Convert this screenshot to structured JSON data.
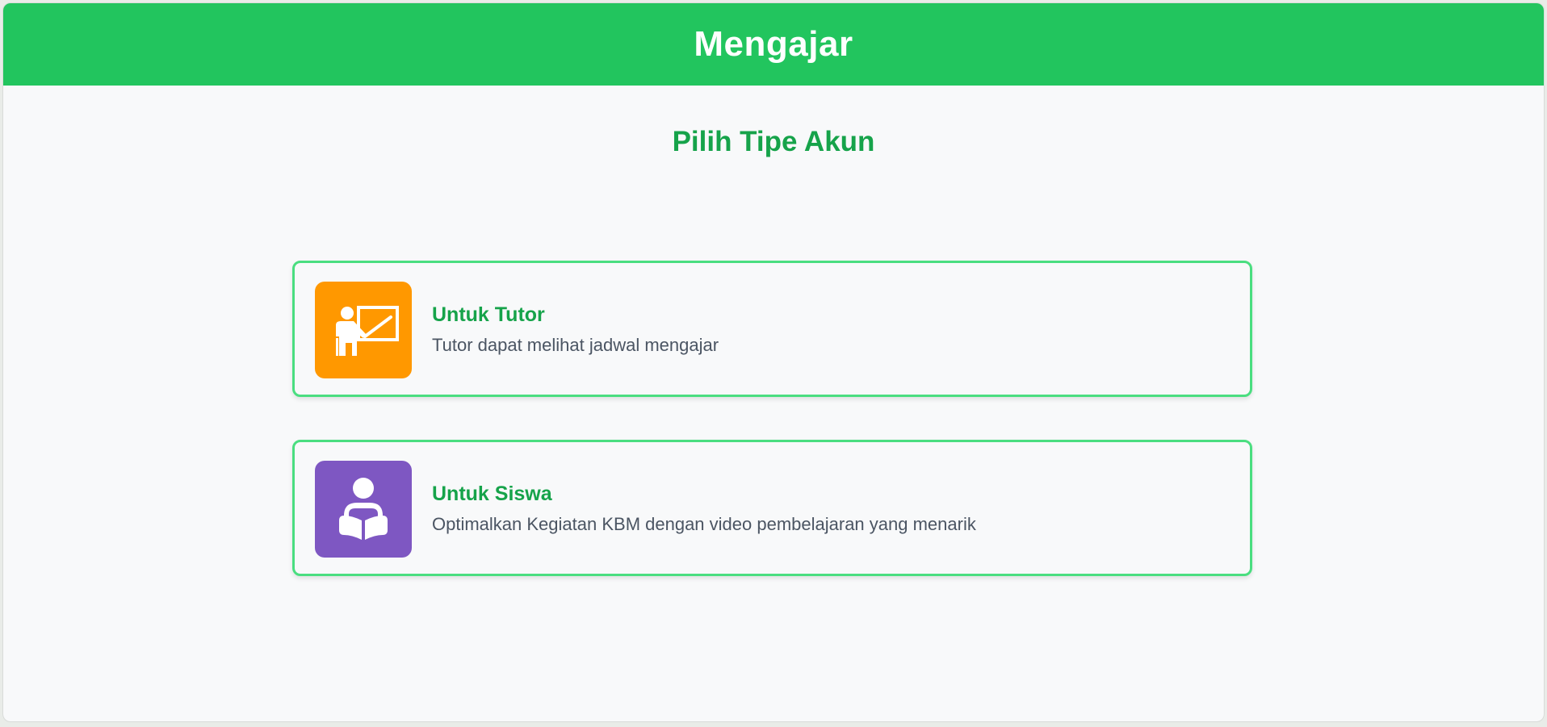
{
  "header": {
    "title": "Mengajar",
    "color": "#22c55e"
  },
  "main": {
    "subtitle": "Pilih Tipe Akun",
    "cards": [
      {
        "title": "Untuk Tutor",
        "description": "Tutor dapat melihat jadwal mengajar",
        "icon": "teacher-board-icon",
        "icon_color": "#ff9800"
      },
      {
        "title": "Untuk Siswa",
        "description": "Optimalkan Kegiatan KBM dengan video pembelajaran yang menarik",
        "icon": "student-reading-icon",
        "icon_color": "#7e57c2"
      }
    ]
  }
}
